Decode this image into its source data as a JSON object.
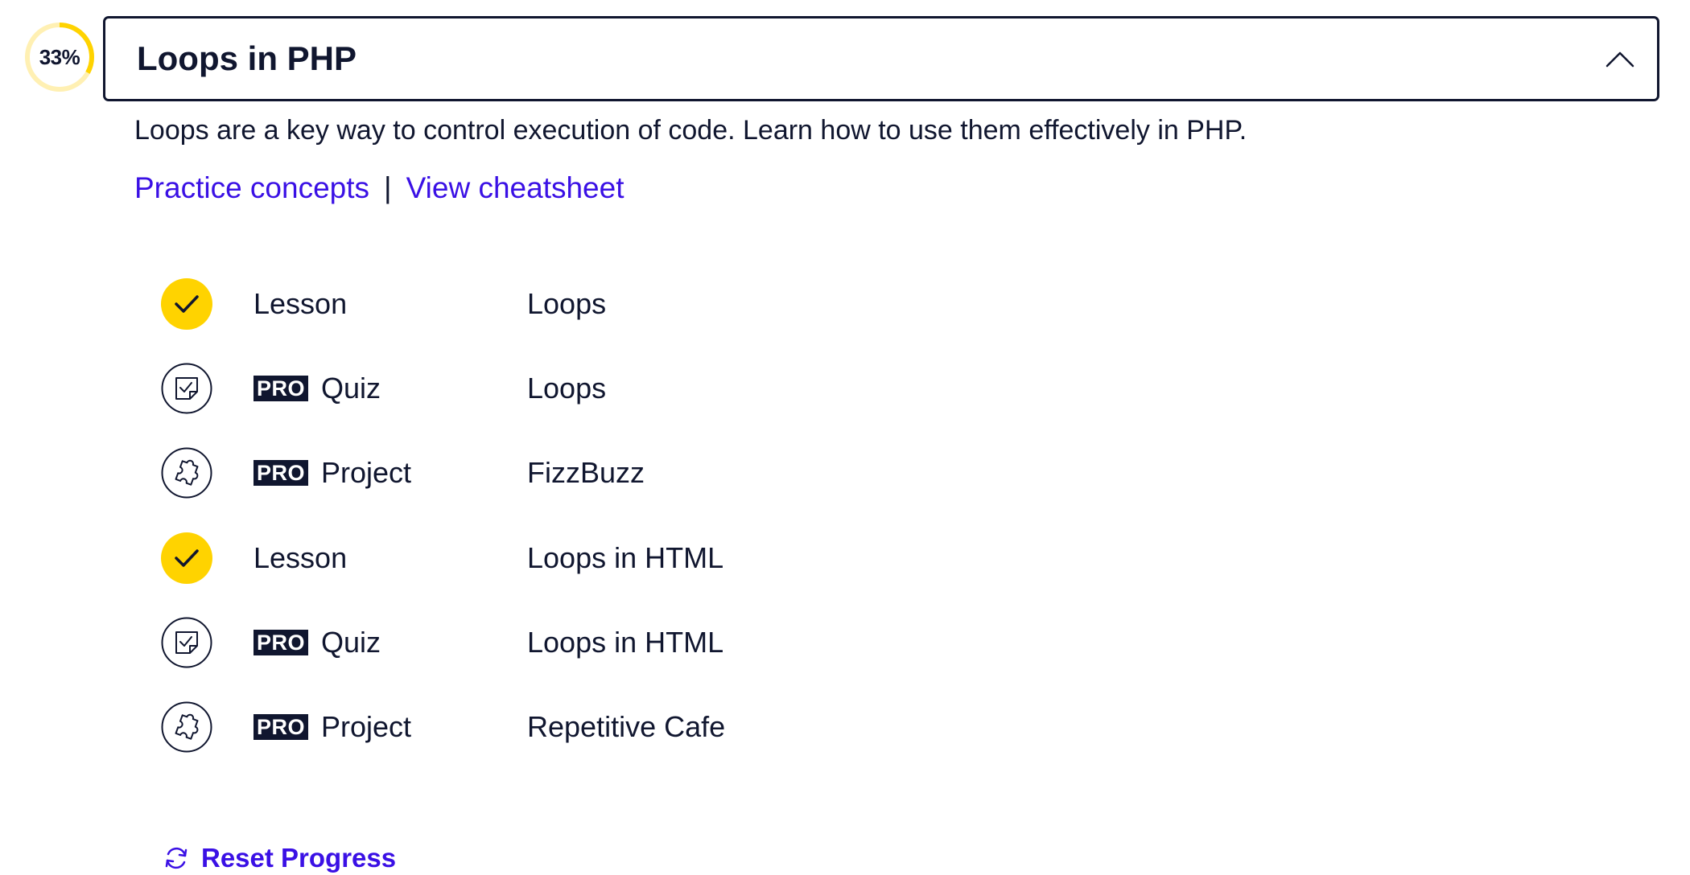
{
  "progress": {
    "percent_label": "33%",
    "fraction": 0.33
  },
  "module": {
    "title": "Loops in PHP",
    "description": "Loops are a key way to control execution of code. Learn how to use them effectively in PHP.",
    "links": {
      "practice": "Practice concepts",
      "separator": "|",
      "cheatsheet": "View cheatsheet"
    }
  },
  "items": [
    {
      "status": "complete",
      "pro": "",
      "kind": "Lesson",
      "name": "Loops",
      "icon": "check-icon"
    },
    {
      "status": "pending",
      "pro": "PRO",
      "kind": "Quiz",
      "name": "Loops",
      "icon": "quiz-icon"
    },
    {
      "status": "pending",
      "pro": "PRO",
      "kind": "Project",
      "name": "FizzBuzz",
      "icon": "puzzle-piece-icon"
    },
    {
      "status": "complete",
      "pro": "",
      "kind": "Lesson",
      "name": "Loops in HTML",
      "icon": "check-icon"
    },
    {
      "status": "pending",
      "pro": "PRO",
      "kind": "Quiz",
      "name": "Loops in HTML",
      "icon": "quiz-icon"
    },
    {
      "status": "pending",
      "pro": "PRO",
      "kind": "Project",
      "name": "Repetitive Cafe",
      "icon": "puzzle-piece-icon"
    }
  ],
  "reset": {
    "label": "Reset Progress",
    "icon": "reset-icon"
  },
  "colors": {
    "accent": "#3a10e5",
    "ink": "#10162f",
    "complete": "#ffd300",
    "ring_track": "#fff0b3"
  }
}
